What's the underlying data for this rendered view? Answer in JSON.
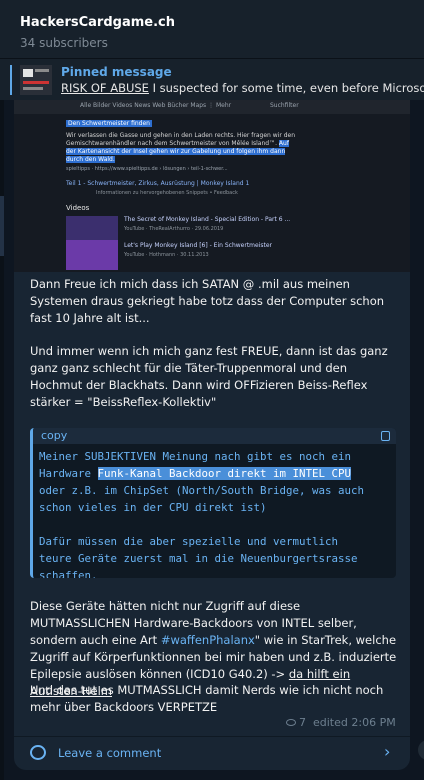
{
  "header": {
    "title": "HackersCardgame.ch",
    "subscribers": "34 subscribers"
  },
  "pinned": {
    "label": "Pinned message",
    "text_underlined": "RISK OF ABUSE",
    "text_rest": " I suspected for some time, even before Microsoft V"
  },
  "media": {
    "nav": "Alle   Bilder   Videos   News   Web   Bücher   Maps   ⋮ Mehr",
    "nav_right": "Suchfilter",
    "highlight_title": "Den Schwertmeister finden",
    "body_plain": "Wir verlassen die Gasse und gehen in den Laden rechts. Hier fragen wir den Gemischtwarenhändler nach dem Schwertmeister von Mêlée Island™. ",
    "body_highlight": "Auf der Kartenansicht der Insel gehen wir zur Gabelung und folgen ihm dann durch den Wald.",
    "source": "spieltipps · https://www.spieltipps.de › lösungen › teil-1-schwer...",
    "source_link": "Teil 1 - Schwertmeister, Zirkus, Ausrüstung | Monkey Island 1",
    "source_note": "Informationen zu hervorgehobenen Snippets  •  Feedback",
    "videos_label": "Videos",
    "video1_title": "The Secret of Monkey Island - Special Edition - Part 6 ...",
    "video1_meta": "YouTube · TheRealArthurro  ·  29.06.2019",
    "video2_title": "Let's Play Monkey Island [6] - Ein Schwertmeister",
    "video2_meta": "YouTube · Hothmann  ·  30.11.2013"
  },
  "message": {
    "p1": "Dann Freue ich mich dass ich SATAN @ .mil aus meinen Systemen draus gekriegt habe totz dass der Computer schon fast 10 Jahre alt ist...",
    "p2": "Und immer wenn ich mich ganz fest FREUE, dann ist das ganz ganz ganz schlecht für die Täter-Truppenmoral und den Hochmut der Blackhats. Dann wird OFFizieren Beiss-Reflex stärker = \"BeissReflex-Kollektiv\"",
    "code_label": "copy",
    "code_line1": "Meiner SUBJEKTIVEN Meinung nach gibt es noch ein",
    "code_line2_pre": "Hardware ",
    "code_line2_sel": "Funk-Kanal Backdoor direkt im INTEL CPU",
    "code_line3": "oder z.B. im ChipSet (North/South Bridge, was auch",
    "code_line4": "schon vieles in der CPU direkt ist)",
    "code_line5": "",
    "code_line6": "Dafür müssen die aber spezielle und vermutlich",
    "code_line7": "teure Geräte zuerst mal in die Neuenburgertsrasse",
    "code_line8": "schaffen.",
    "p4_a": "Diese Geräte hätten nicht nur Zugriff auf diese MUTMASSLICHEN Hardware-Backdoors von INTEL selber, sondern auch eine Art ",
    "p4_hashtag": "#waffenPhalanx",
    "p4_b": "\" wie in StarTrek, welche Zugriff auf Körperfunktionnen bei mir haben und z.B. induzierte Epilepsie auslösen können (ICD10 G40.2) -> ",
    "p4_link": "da hilft ein Autisten-Helm",
    "p5": "Und das tut es MUTMASSLICH damit Nerds wie ich nicht noch mehr über Backdoors VERPETZE",
    "views": "7",
    "edited": "edited 2:06 PM"
  },
  "comment": {
    "label": "Leave a comment"
  }
}
